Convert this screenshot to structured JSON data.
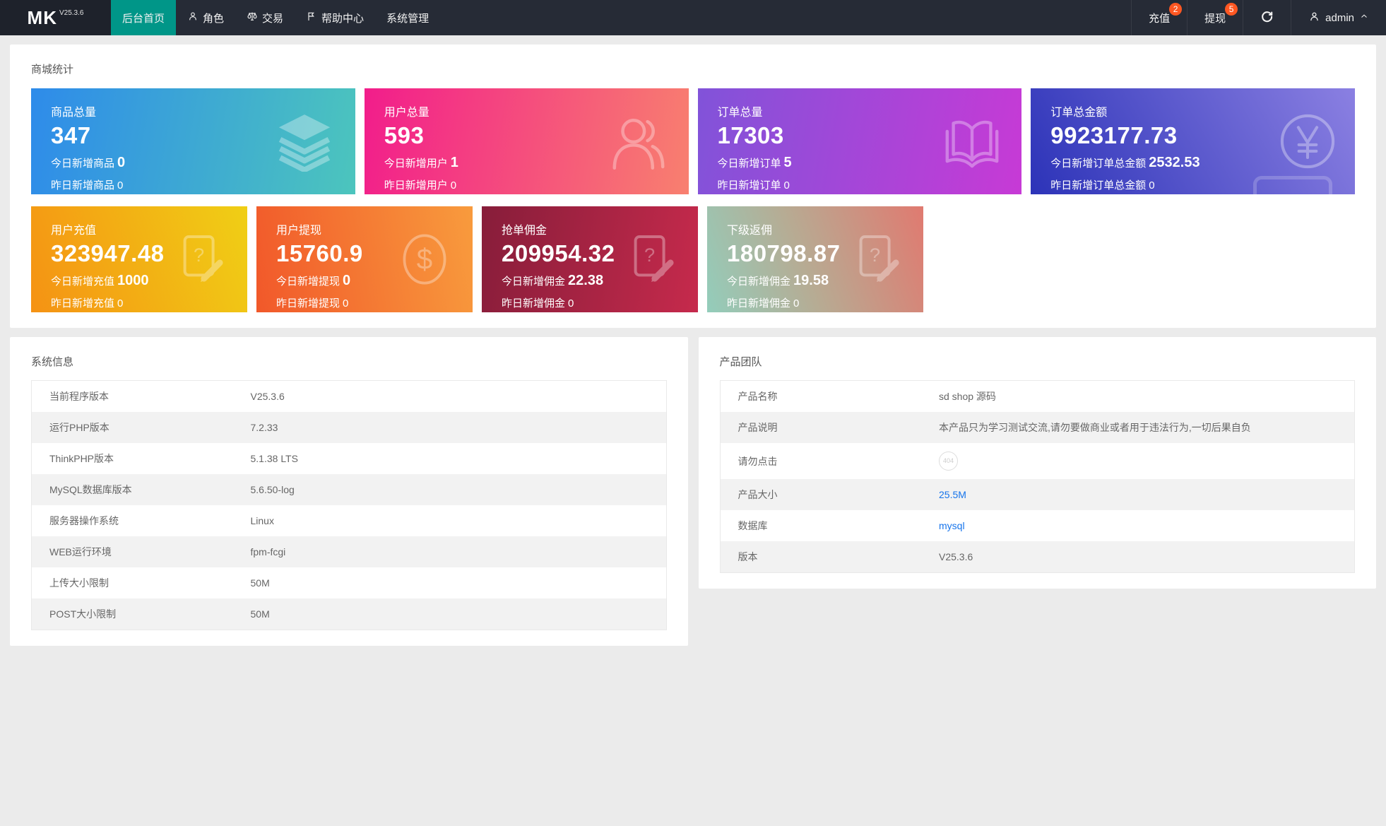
{
  "navbar": {
    "brand": {
      "name": "MK",
      "version": "V25.3.6"
    },
    "menu": [
      {
        "label": "后台首页"
      },
      {
        "label": "角色"
      },
      {
        "label": "交易"
      },
      {
        "label": "帮助中心"
      },
      {
        "label": "系统管理"
      }
    ],
    "actions": {
      "recharge": {
        "label": "充值",
        "badge": "2"
      },
      "withdraw": {
        "label": "提现",
        "badge": "5"
      },
      "user": {
        "name": "admin"
      }
    }
  },
  "stats": {
    "section_title": "商城统计",
    "cards": [
      {
        "label": "商品总量",
        "value": "347",
        "today_label": "今日新增商品",
        "today_value": "0",
        "yesterday_label": "昨日新增商品",
        "yesterday_value": "0",
        "icon": "layers-icon",
        "gradient": "#2e8bea→#4cc5bd"
      },
      {
        "label": "用户总量",
        "value": "593",
        "today_label": "今日新增用户",
        "today_value": "1",
        "yesterday_label": "昨日新增用户",
        "yesterday_value": "0",
        "icon": "users-icon",
        "gradient": "#f21d8b→#f8806f"
      },
      {
        "label": "订单总量",
        "value": "17303",
        "today_label": "今日新增订单",
        "today_value": "5",
        "yesterday_label": "昨日新增订单",
        "yesterday_value": "0",
        "icon": "book-icon",
        "gradient": "#8153d9→#c73ad6"
      },
      {
        "label": "订单总金额",
        "value": "9923177.73",
        "today_label": "今日新增订单总金额",
        "today_value": "2532.53",
        "yesterday_label": "昨日新增订单总金额",
        "yesterday_value": "0",
        "icon": "yen-icon",
        "gradient": "#2c33b8→#8b80e2"
      },
      {
        "label": "用户充值",
        "value": "323947.48",
        "today_label": "今日新增充值",
        "today_value": "1000",
        "yesterday_label": "昨日新增充值",
        "yesterday_value": "0",
        "icon": "doc-question-icon",
        "gradient": "#f59214→#f0cf15"
      },
      {
        "label": "用户提现",
        "value": "15760.9",
        "today_label": "今日新增提现",
        "today_value": "0",
        "yesterday_label": "昨日新增提现",
        "yesterday_value": "0",
        "icon": "dollar-icon",
        "gradient": "#f1582a→#f89b3d"
      },
      {
        "label": "抢单佣金",
        "value": "209954.32",
        "today_label": "今日新增佣金",
        "today_value": "22.38",
        "yesterday_label": "昨日新增佣金",
        "yesterday_value": "0",
        "icon": "doc-question-icon",
        "gradient": "#871d3a→#c62a4c"
      },
      {
        "label": "下级返佣",
        "value": "180798.87",
        "today_label": "今日新增佣金",
        "today_value": "19.58",
        "yesterday_label": "昨日新增佣金",
        "yesterday_value": "0",
        "icon": "doc-question-icon",
        "gradient": "#93cdbb→#e07a70"
      }
    ]
  },
  "system_info": {
    "title": "系统信息",
    "rows": [
      {
        "label": "当前程序版本",
        "value": "V25.3.6"
      },
      {
        "label": "运行PHP版本",
        "value": "7.2.33"
      },
      {
        "label": "ThinkPHP版本",
        "value": "5.1.38 LTS"
      },
      {
        "label": "MySQL数据库版本",
        "value": "5.6.50-log"
      },
      {
        "label": "服务器操作系统",
        "value": "Linux"
      },
      {
        "label": "WEB运行环境",
        "value": "fpm-fcgi"
      },
      {
        "label": "上传大小限制",
        "value": "50M"
      },
      {
        "label": "POST大小限制",
        "value": "50M"
      }
    ]
  },
  "product_team": {
    "title": "产品团队",
    "rows": [
      {
        "label": "产品名称",
        "value": "sd shop 源码"
      },
      {
        "label": "产品说明",
        "value": "本产品只为学习测试交流,请勿要做商业或者用于违法行为,一切后果自负"
      },
      {
        "label": "请勿点击",
        "value": "404"
      },
      {
        "label": "产品大小",
        "value": "25.5M"
      },
      {
        "label": "数据库",
        "value": "mysql"
      },
      {
        "label": "版本",
        "value": "V25.3.6"
      }
    ]
  },
  "colors": {
    "navbar_bg": "#262b36",
    "brand_bg": "#1e222b",
    "active_tab": "#009688",
    "badge": "#ff5722",
    "link": "#1674eb",
    "page_bg": "#ebebeb"
  }
}
